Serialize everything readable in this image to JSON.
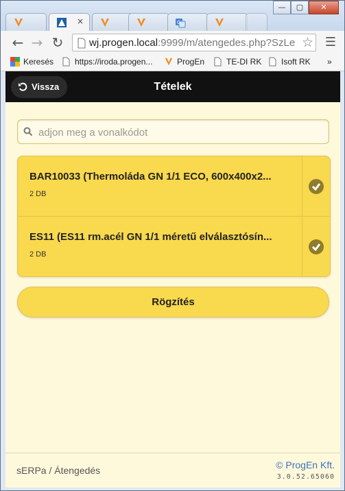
{
  "browser": {
    "tabs": [
      {
        "icon": "progen-logo-icon"
      },
      {
        "icon": "app-icon",
        "close": "×"
      },
      {
        "icon": "progen-logo-icon"
      },
      {
        "icon": "progen-logo-icon"
      },
      {
        "icon": "translate-icon"
      },
      {
        "icon": "progen-logo-icon"
      }
    ],
    "window_controls": {
      "minimize": "—",
      "maximize": "▢",
      "close": "✕"
    },
    "nav": {
      "back": "←",
      "forward": "→",
      "reload": "↻"
    },
    "url": {
      "host": "wj.progen.local",
      "rest": ":9999/m/atengedes.php?SzLe"
    },
    "bookmarks": [
      "Keresés",
      "https://iroda.progen...",
      "ProgEn",
      "TE-DI RK",
      "Isoft RK"
    ],
    "bookmarks_more": "»"
  },
  "header": {
    "back_label": "Vissza",
    "title": "Tételek"
  },
  "search": {
    "placeholder": "adjon meg a vonalkódot"
  },
  "items": [
    {
      "title": "BAR10033 (Thermoláda GN 1/1 ECO, 600x400x2...",
      "qty": "2 DB"
    },
    {
      "title": "ES11 (ES11 rm.acél GN 1/1 méretű elválasztósín...",
      "qty": "2 DB"
    }
  ],
  "save_label": "Rögzítés",
  "footer": {
    "breadcrumb": "sERPa / Átengedés",
    "brand": "© ProgEn Kft.",
    "version": "3.0.52.65060"
  },
  "colors": {
    "accent": "#f9d94d",
    "page_bg": "#fff9dc",
    "header_bg": "#111111",
    "brand_link": "#3b73b9"
  }
}
